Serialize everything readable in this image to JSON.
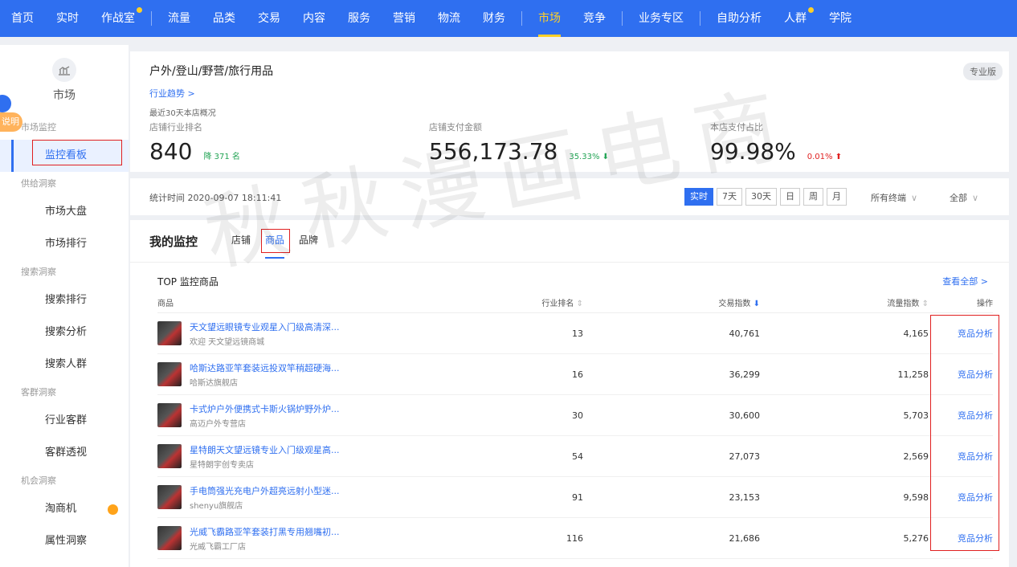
{
  "nav": {
    "items": [
      {
        "label": "首页"
      },
      {
        "label": "实时"
      },
      {
        "label": "作战室",
        "dot": true
      },
      {
        "label": "流量"
      },
      {
        "label": "品类"
      },
      {
        "label": "交易"
      },
      {
        "label": "内容"
      },
      {
        "label": "服务"
      },
      {
        "label": "营销"
      },
      {
        "label": "物流"
      },
      {
        "label": "财务"
      },
      {
        "label": "市场",
        "active": true
      },
      {
        "label": "竞争"
      },
      {
        "label": "业务专区"
      },
      {
        "label": "自助分析"
      },
      {
        "label": "人群",
        "dot": true
      },
      {
        "label": "学院"
      }
    ]
  },
  "sidebar": {
    "help_label": "说明",
    "title": "市场",
    "groups": [
      {
        "label": "市场监控",
        "items": [
          {
            "label": "监控看板",
            "active": true
          }
        ]
      },
      {
        "label": "供给洞察",
        "items": [
          {
            "label": "市场大盘"
          },
          {
            "label": "市场排行"
          }
        ]
      },
      {
        "label": "搜索洞察",
        "items": [
          {
            "label": "搜索排行"
          },
          {
            "label": "搜索分析"
          },
          {
            "label": "搜索人群"
          }
        ]
      },
      {
        "label": "客群洞察",
        "items": [
          {
            "label": "行业客群"
          },
          {
            "label": "客群透视"
          }
        ]
      },
      {
        "label": "机会洞察",
        "items": [
          {
            "label": "淘商机"
          },
          {
            "label": "属性洞察"
          }
        ]
      }
    ]
  },
  "overview": {
    "category": "户外/登山/野营/旅行用品",
    "pro_badge": "专业版",
    "trend_link": "行业趋势 >",
    "summary_label": "最近30天本店概况",
    "rank_label": "店铺行业排名",
    "rank_value": "840",
    "rank_change": "降 371 名",
    "pay_label": "店铺支付金额",
    "pay_value": "556,173.78",
    "pay_change": "35.33% ⬇",
    "share_label": "本店支付占比",
    "share_value": "99.98%",
    "share_change": "0.01% ⬆"
  },
  "filter": {
    "time_label": "统计时间 2020-09-07 18:11:41",
    "tabs": [
      "实时",
      "7天",
      "30天",
      "日",
      "周",
      "月"
    ],
    "terminal": "所有终端",
    "scope": "全部"
  },
  "monitor": {
    "title": "我的监控",
    "tabs": [
      "店铺",
      "商品",
      "品牌"
    ],
    "top_title": "TOP 监控商品",
    "view_all": "查看全部 >",
    "columns": {
      "product": "商品",
      "rank": "行业排名",
      "trade": "交易指数",
      "flow": "流量指数",
      "op": "操作"
    },
    "rows": [
      {
        "name": "天文望远眼镜专业观星入门级高清深...",
        "shop": "欢迎 天文望远镜商城",
        "rank": "13",
        "trade": "40,761",
        "flow": "4,165",
        "op": "竞品分析"
      },
      {
        "name": "哈斯达路亚竿套装远投双竿稍超硬海...",
        "shop": "哈斯达旗舰店",
        "rank": "16",
        "trade": "36,299",
        "flow": "11,258",
        "op": "竞品分析"
      },
      {
        "name": "卡式炉户外便携式卡斯火锅炉野外炉...",
        "shop": "高迈户外专营店",
        "rank": "30",
        "trade": "30,600",
        "flow": "5,703",
        "op": "竞品分析"
      },
      {
        "name": "星特朗天文望远镜专业入门级观星高...",
        "shop": "星特朗宇创专卖店",
        "rank": "54",
        "trade": "27,073",
        "flow": "2,569",
        "op": "竞品分析"
      },
      {
        "name": "手电筒强光充电户外超亮远射小型迷...",
        "shop": "shenyu旗舰店",
        "rank": "91",
        "trade": "23,153",
        "flow": "9,598",
        "op": "竞品分析"
      },
      {
        "name": "光威飞霸路亚竿套装打黑专用翘嘴初...",
        "shop": "光威飞霸工厂店",
        "rank": "116",
        "trade": "21,686",
        "flow": "5,276",
        "op": "竞品分析"
      }
    ]
  },
  "watermark": "秋秋漫画电商"
}
